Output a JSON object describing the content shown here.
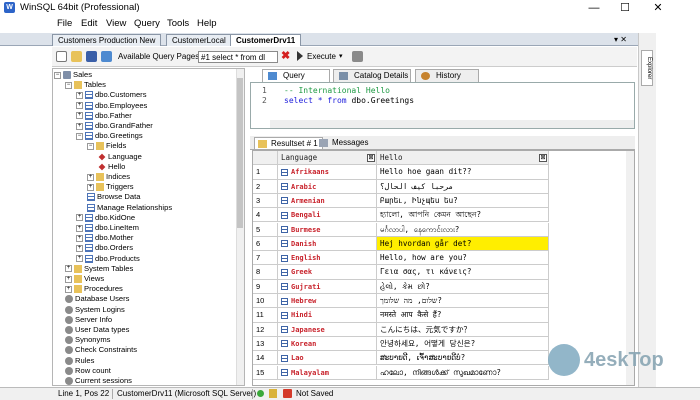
{
  "window": {
    "title": "WinSQL 64bit (Professional)",
    "min": "—",
    "max": "☐",
    "close": "✕"
  },
  "menu": [
    "File",
    "Edit",
    "View",
    "Query",
    "Tools",
    "Help"
  ],
  "doc_tabs": [
    "Customers Production New",
    "CustomerLocal",
    "CustomerDrv11"
  ],
  "doc_tabs_close": "▾ ✕",
  "toolbar": {
    "query_pages_label": "Available Query Pages:",
    "query_pages_value": "#1 select * from dl",
    "execute_label": "Execute"
  },
  "explorer": {
    "label": "Explorer"
  },
  "tree": [
    {
      "exp": "−",
      "icon": "db",
      "label": "Sales"
    },
    {
      "exp": "−",
      "icon": "folder",
      "label": "Tables"
    },
    {
      "exp": "+",
      "icon": "table",
      "label": "dbo.Customers"
    },
    {
      "exp": "+",
      "icon": "table",
      "label": "dbo.Employees"
    },
    {
      "exp": "+",
      "icon": "table",
      "label": "dbo.Father"
    },
    {
      "exp": "+",
      "icon": "table",
      "label": "dbo.GrandFather"
    },
    {
      "exp": "−",
      "icon": "table",
      "label": "dbo.Greetings"
    },
    {
      "exp": "−",
      "icon": "folder",
      "label": "Fields"
    },
    {
      "exp": "",
      "icon": "field",
      "label": "Language"
    },
    {
      "exp": "",
      "icon": "field",
      "label": "Hello"
    },
    {
      "exp": "+",
      "icon": "folder",
      "label": "Indices"
    },
    {
      "exp": "+",
      "icon": "folder",
      "label": "Triggers"
    },
    {
      "exp": "",
      "icon": "table",
      "label": "Browse Data"
    },
    {
      "exp": "",
      "icon": "table",
      "label": "Manage Relationships"
    },
    {
      "exp": "+",
      "icon": "table",
      "label": "dbo.KidOne"
    },
    {
      "exp": "+",
      "icon": "table",
      "label": "dbo.LineItem"
    },
    {
      "exp": "+",
      "icon": "table",
      "label": "dbo.Mother"
    },
    {
      "exp": "+",
      "icon": "table",
      "label": "dbo.Orders"
    },
    {
      "exp": "+",
      "icon": "table",
      "label": "dbo.Products"
    },
    {
      "exp": "+",
      "icon": "folder",
      "label": "System Tables"
    },
    {
      "exp": "+",
      "icon": "folder",
      "label": "Views"
    },
    {
      "exp": "+",
      "icon": "folder",
      "label": "Procedures"
    },
    {
      "exp": "",
      "icon": "gear",
      "label": "Database Users"
    },
    {
      "exp": "",
      "icon": "gear",
      "label": "System Logins"
    },
    {
      "exp": "",
      "icon": "gear",
      "label": "Server Info"
    },
    {
      "exp": "",
      "icon": "gear",
      "label": "User Data types"
    },
    {
      "exp": "",
      "icon": "gear",
      "label": "Synonyms"
    },
    {
      "exp": "",
      "icon": "gear",
      "label": "Check Constraints"
    },
    {
      "exp": "",
      "icon": "gear",
      "label": "Rules"
    },
    {
      "exp": "",
      "icon": "gear",
      "label": "Row count"
    },
    {
      "exp": "",
      "icon": "gear",
      "label": "Current sessions"
    }
  ],
  "query_tabs": [
    "Query",
    "Catalog Details",
    "History"
  ],
  "editor": {
    "lines": [
      {
        "num": "1",
        "comment": "-- International Hello",
        "keyword": "",
        "rest": ""
      },
      {
        "num": "2",
        "comment": "",
        "keyword": "select * from",
        "rest": " dbo.Greetings"
      }
    ]
  },
  "result_tabs": [
    "Resultset # 1",
    "Messages"
  ],
  "grid": {
    "columns": [
      "Language",
      "Hello"
    ],
    "header_btn": "⊠",
    "highlight_row": 6,
    "rows": [
      {
        "n": "1",
        "lang": "Afrikaans",
        "hello": "Hello hoe gaan dit??"
      },
      {
        "n": "2",
        "lang": "Arabic",
        "hello": "مرحبا كيف الحال؟"
      },
      {
        "n": "3",
        "lang": "Armenian",
        "hello": "Բարեւ, Ինչպես ես?"
      },
      {
        "n": "4",
        "lang": "Bengali",
        "hello": "হ্যালো, আপনি কেমন আছেন?"
      },
      {
        "n": "5",
        "lang": "Burmese",
        "hello": "မင်္ဂလာပါ, နေကောင်းလား?"
      },
      {
        "n": "6",
        "lang": "Danish",
        "hello": "Hej hvordan går det?"
      },
      {
        "n": "7",
        "lang": "English",
        "hello": "Hello, how are you?"
      },
      {
        "n": "8",
        "lang": "Greek",
        "hello": "Γεια σας, τι κάνεις?"
      },
      {
        "n": "9",
        "lang": "Gujrati",
        "hello": "હેલો, કેમ છો?"
      },
      {
        "n": "10",
        "lang": "Hebrew",
        "hello": "שלום, מה שלומך?"
      },
      {
        "n": "11",
        "lang": "Hindi",
        "hello": "नमस्ते आप कैसे हैं?"
      },
      {
        "n": "12",
        "lang": "Japanese",
        "hello": "こんにちは、元気ですか？"
      },
      {
        "n": "13",
        "lang": "Korean",
        "hello": "안녕하세요, 어떻게 당신은?"
      },
      {
        "n": "14",
        "lang": "Lao",
        "hello": "ສະບາຍດີ, ເຈົ້າສະບາຍດີບໍ?"
      },
      {
        "n": "15",
        "lang": "Malayalam",
        "hello": "ഹലോ, നിങ്ങൾക്ക് സുഖമാണോ?"
      }
    ]
  },
  "status": {
    "position": "Line 1, Pos 22",
    "connection": "CustomerDrv11 (Microsoft SQL Server)",
    "saved": "Not Saved"
  },
  "watermark": {
    "text": "4eskTop"
  },
  "colors": {
    "language_text": "#c8232c",
    "highlight": "#ffee00",
    "comment": "#1f9a44",
    "keyword": "#1d1ddc"
  }
}
